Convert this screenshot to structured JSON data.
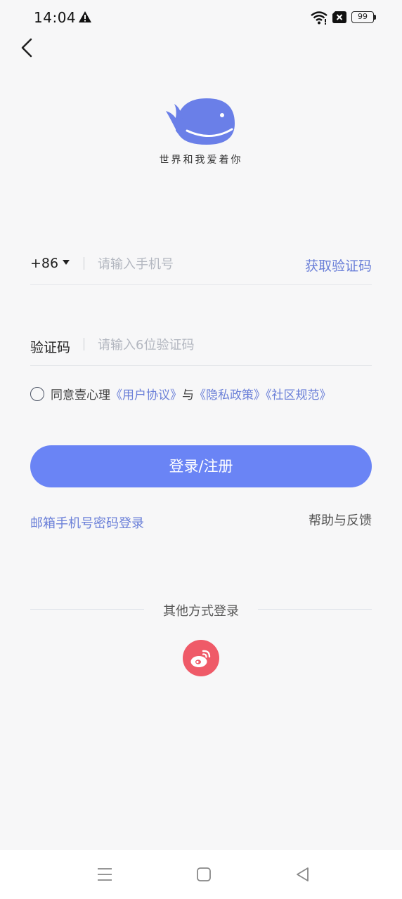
{
  "status_bar": {
    "time": "14:04",
    "battery": "99",
    "icons": [
      "warning-icon",
      "wifi-icon",
      "no-sim-icon",
      "battery-icon"
    ]
  },
  "header": {
    "back_icon": "chevron-left-icon"
  },
  "logo": {
    "slogan": "世界和我爱着你",
    "colors": {
      "whale": "#6a7fe8"
    }
  },
  "form": {
    "country_code": "+86",
    "phone_placeholder": "请输入手机号",
    "get_code_label": "获取验证码",
    "code_label": "验证码",
    "code_placeholder": "请输入6位验证码"
  },
  "agreement": {
    "prefix": "同意壹心理",
    "user_agreement": "《用户协议》",
    "and": "与",
    "privacy_policy": "《隐私政策》",
    "community_rules": "《社区规范》"
  },
  "actions": {
    "login_label": "登录/注册",
    "email_login_label": "邮箱手机号密码登录",
    "help_label": "帮助与反馈"
  },
  "other_login": {
    "title": "其他方式登录",
    "weibo_icon": "weibo-icon"
  },
  "nav_bar": {
    "icons": [
      "menu-icon",
      "home-square-icon",
      "back-triangle-icon"
    ]
  },
  "colors": {
    "accent": "#6a84f5",
    "link": "#6a7fd8",
    "weibo": "#ef5a68",
    "background": "#f7f7f8"
  }
}
